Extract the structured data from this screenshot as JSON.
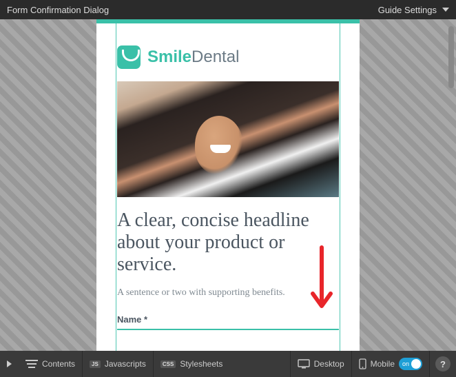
{
  "topBar": {
    "title": "Form Confirmation Dialog",
    "settings": "Guide Settings"
  },
  "page": {
    "brand": {
      "bold": "Smile",
      "light": "Dental"
    },
    "headline": "A clear, concise headline about your product or service.",
    "subhead": "A sentence or two with supporting benefits.",
    "field1Label": "Name *"
  },
  "bottomBar": {
    "contents": "Contents",
    "jsBadge": "JS",
    "javascripts": "Javascripts",
    "cssBadge": "CSS",
    "stylesheets": "Stylesheets",
    "desktop": "Desktop",
    "mobile": "Mobile",
    "toggleState": "on",
    "help": "?"
  }
}
